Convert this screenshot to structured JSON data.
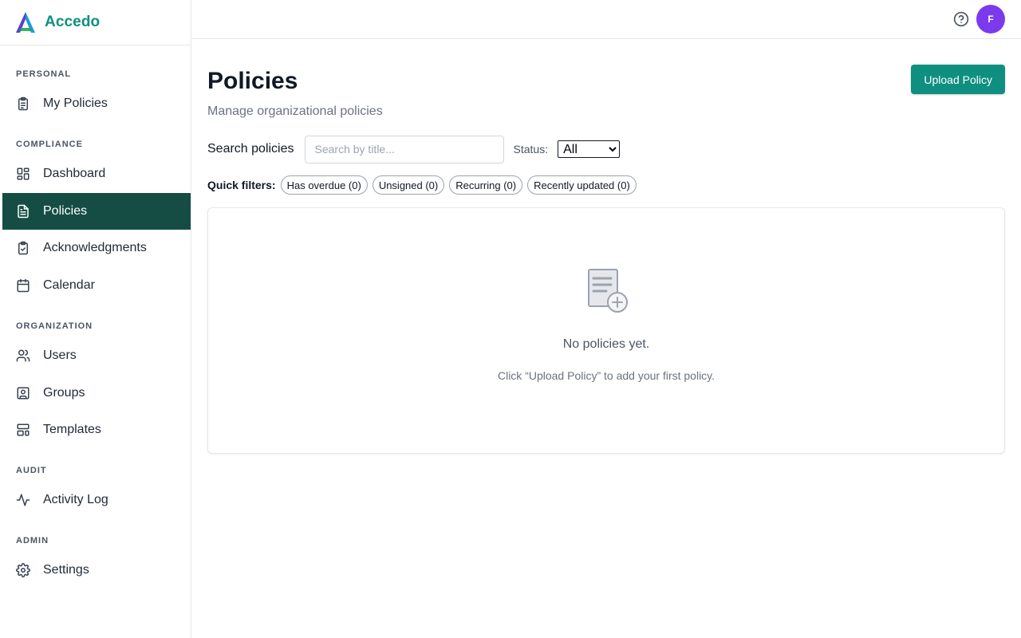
{
  "brand": {
    "name": "Accedo"
  },
  "sidebar": {
    "sections": [
      {
        "label": "PERSONAL",
        "items": [
          {
            "label": "My Policies",
            "icon": "clipboard-list-icon"
          }
        ]
      },
      {
        "label": "COMPLIANCE",
        "items": [
          {
            "label": "Dashboard",
            "icon": "dashboard-grid-icon"
          },
          {
            "label": "Policies",
            "icon": "document-icon",
            "active": true
          },
          {
            "label": "Acknowledgments",
            "icon": "clipboard-check-icon"
          },
          {
            "label": "Calendar",
            "icon": "calendar-icon"
          }
        ]
      },
      {
        "label": "ORGANIZATION",
        "items": [
          {
            "label": "Users",
            "icon": "users-icon"
          },
          {
            "label": "Groups",
            "icon": "contact-icon"
          },
          {
            "label": "Templates",
            "icon": "layout-template-icon"
          }
        ]
      },
      {
        "label": "AUDIT",
        "items": [
          {
            "label": "Activity Log",
            "icon": "activity-icon"
          }
        ]
      },
      {
        "label": "ADMIN",
        "items": [
          {
            "label": "Settings",
            "icon": "gear-icon"
          }
        ]
      }
    ]
  },
  "topbar": {
    "avatar_initial": "F",
    "help_icon": "help-circle-icon"
  },
  "main": {
    "title": "Policies",
    "subtitle": "Manage organizational policies",
    "upload_label": "Upload Policy",
    "search": {
      "label": "Search policies",
      "placeholder": "Search by title...",
      "value": ""
    },
    "status": {
      "label": "Status:",
      "selected": "All"
    },
    "filters": {
      "label": "Quick filters:",
      "chips": [
        "Has overdue (0)",
        "Unsigned (0)",
        "Recurring (0)",
        "Recently updated (0)"
      ]
    },
    "empty": {
      "icon": "document-add-icon",
      "title": "No policies yet.",
      "hint": "Click “Upload Policy” to add your first policy."
    }
  },
  "colors": {
    "accent": "#0f8f80",
    "active_nav_bg": "#154d44",
    "avatar_bg": "#7c3aed"
  }
}
